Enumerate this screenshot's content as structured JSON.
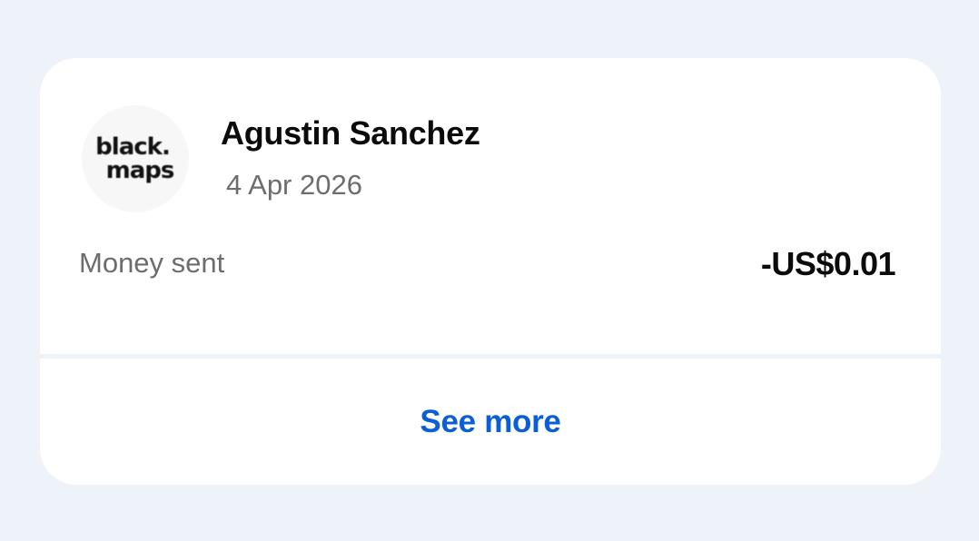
{
  "transaction": {
    "logo": {
      "line1": "black.",
      "line2": "maps",
      "icon": "merchant-logo"
    },
    "name": "Agustin Sanchez",
    "date": "4 Apr 2026",
    "type_label": "Money sent",
    "amount": "-US$0.01"
  },
  "actions": {
    "see_more_label": "See more"
  },
  "colors": {
    "background": "#eef2f9",
    "card": "#ffffff",
    "primary_text": "#0b0b0b",
    "secondary_text": "#6d6d6d",
    "link": "#0a5fd8"
  }
}
